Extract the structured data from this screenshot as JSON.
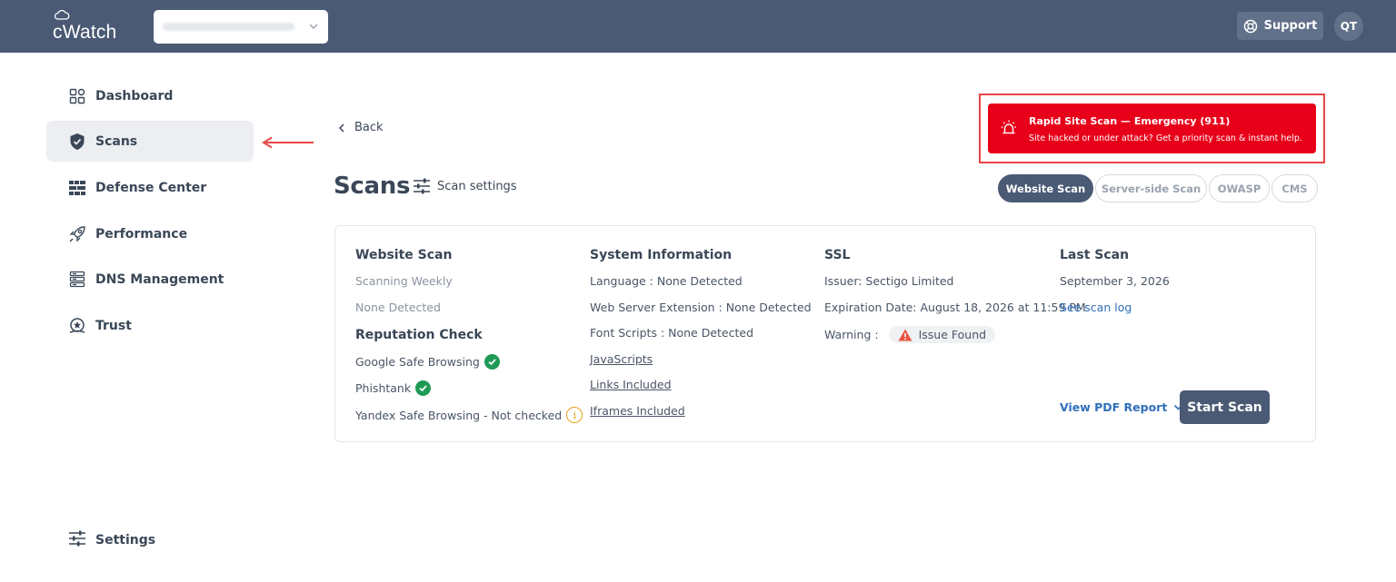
{
  "header": {
    "logo_text": "cWatch",
    "site_selector": "",
    "support_label": "Support",
    "avatar_initials": "QT"
  },
  "sidebar": {
    "items": [
      {
        "label": "Dashboard",
        "icon": "dashboard-icon"
      },
      {
        "label": "Scans",
        "icon": "shield-check-icon",
        "active": true
      },
      {
        "label": "Defense Center",
        "icon": "brick-wall-icon"
      },
      {
        "label": "Performance",
        "icon": "rocket-icon"
      },
      {
        "label": "DNS Management",
        "icon": "server-icon"
      },
      {
        "label": "Trust",
        "icon": "badge-icon"
      }
    ],
    "settings_label": "Settings"
  },
  "main": {
    "back_label": "Back",
    "title": "Scans",
    "scan_settings_label": "Scan settings",
    "emergency": {
      "title": "Rapid Site Scan — Emergency (911)",
      "subtitle": "Site hacked or under attack? Get a priority scan & instant help."
    },
    "tabs": [
      {
        "label": "Website Scan",
        "active": true
      },
      {
        "label": "Server-side Scan"
      },
      {
        "label": "OWASP"
      },
      {
        "label": "CMS"
      }
    ],
    "card": {
      "website_scan": {
        "heading": "Website Scan",
        "frequency": "Scanning Weekly",
        "detected": "None Detected"
      },
      "reputation": {
        "heading": "Reputation Check",
        "google": "Google Safe Browsing",
        "phishtank": "Phishtank",
        "yandex": "Yandex Safe Browsing - Not checked"
      },
      "system": {
        "heading": "System Information",
        "language": "Language : None Detected",
        "web_server": "Web Server Extension : None Detected",
        "font_scripts": "Font Scripts : None Detected",
        "javascripts": "JavaScripts",
        "links": "Links Included",
        "iframes": "Iframes Included"
      },
      "ssl": {
        "heading": "SSL",
        "issuer": "Issuer: Sectigo Limited",
        "expiration": "Expiration Date: August 18, 2026 at 11:59 PM",
        "warning_label": "Warning :",
        "issue_badge": "Issue Found"
      },
      "last_scan": {
        "heading": "Last Scan",
        "date": "September 3, 2026",
        "scan_log": "See scan log"
      },
      "pdf_report_label": "View PDF Report",
      "start_scan_label": "Start Scan"
    }
  },
  "colors": {
    "header_bg": "#4a5a74",
    "emergency_red": "#e8001a",
    "check_green": "#1f9a55",
    "info_orange": "#e6a01a",
    "link_blue": "#2f6fba"
  }
}
